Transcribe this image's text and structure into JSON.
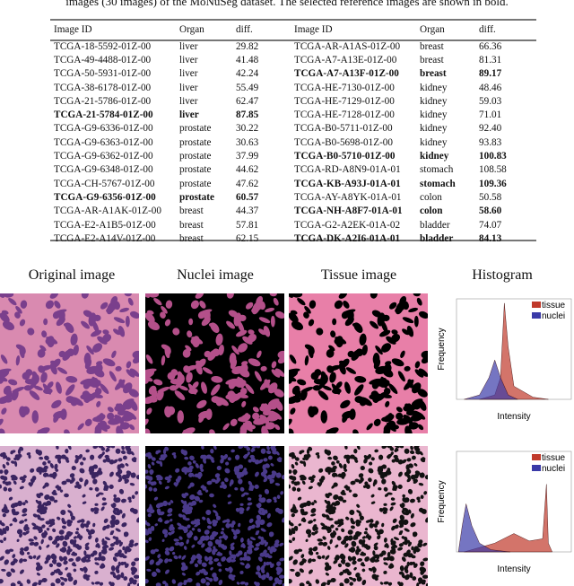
{
  "caption": "images (30 images) of the MoNuSeg dataset. The selected reference images are shown in bold.",
  "table": {
    "headers": [
      "Image ID",
      "Organ",
      "diff.",
      "Image ID",
      "Organ",
      "diff."
    ],
    "rows": [
      [
        {
          "id": "TCGA-18-5592-01Z-00",
          "organ": "liver",
          "diff": "29.82",
          "bold": false
        },
        {
          "id": "TCGA-AR-A1AS-01Z-00",
          "organ": "breast",
          "diff": "66.36",
          "bold": false
        }
      ],
      [
        {
          "id": "TCGA-49-4488-01Z-00",
          "organ": "liver",
          "diff": "41.48",
          "bold": false
        },
        {
          "id": "TCGA-A7-A13E-01Z-00",
          "organ": "breast",
          "diff": "81.31",
          "bold": false
        }
      ],
      [
        {
          "id": "TCGA-50-5931-01Z-00",
          "organ": "liver",
          "diff": "42.24",
          "bold": false
        },
        {
          "id": "TCGA-A7-A13F-01Z-00",
          "organ": "breast",
          "diff": "89.17",
          "bold": true
        }
      ],
      [
        {
          "id": "TCGA-38-6178-01Z-00",
          "organ": "liver",
          "diff": "55.49",
          "bold": false
        },
        {
          "id": "TCGA-HE-7130-01Z-00",
          "organ": "kidney",
          "diff": "48.46",
          "bold": false
        }
      ],
      [
        {
          "id": "TCGA-21-5786-01Z-00",
          "organ": "liver",
          "diff": "62.47",
          "bold": false
        },
        {
          "id": "TCGA-HE-7129-01Z-00",
          "organ": "kidney",
          "diff": "59.03",
          "bold": false
        }
      ],
      [
        {
          "id": "TCGA-21-5784-01Z-00",
          "organ": "liver",
          "diff": "87.85",
          "bold": true
        },
        {
          "id": "TCGA-HE-7128-01Z-00",
          "organ": "kidney",
          "diff": "71.01",
          "bold": false
        }
      ],
      [
        {
          "id": "TCGA-G9-6336-01Z-00",
          "organ": "prostate",
          "diff": "30.22",
          "bold": false
        },
        {
          "id": "TCGA-B0-5711-01Z-00",
          "organ": "kidney",
          "diff": "92.40",
          "bold": false
        }
      ],
      [
        {
          "id": "TCGA-G9-6363-01Z-00",
          "organ": "prostate",
          "diff": "30.63",
          "bold": false
        },
        {
          "id": "TCGA-B0-5698-01Z-00",
          "organ": "kidney",
          "diff": "93.83",
          "bold": false
        }
      ],
      [
        {
          "id": "TCGA-G9-6362-01Z-00",
          "organ": "prostate",
          "diff": "37.99",
          "bold": false
        },
        {
          "id": "TCGA-B0-5710-01Z-00",
          "organ": "kidney",
          "diff": "100.83",
          "bold": true
        }
      ],
      [
        {
          "id": "TCGA-G9-6348-01Z-00",
          "organ": "prostate",
          "diff": "44.62",
          "bold": false
        },
        {
          "id": "TCGA-RD-A8N9-01A-01",
          "organ": "stomach",
          "diff": "108.58",
          "bold": false
        }
      ],
      [
        {
          "id": "TCGA-CH-5767-01Z-00",
          "organ": "prostate",
          "diff": "47.62",
          "bold": false
        },
        {
          "id": "TCGA-KB-A93J-01A-01",
          "organ": "stomach",
          "diff": "109.36",
          "bold": true
        }
      ],
      [
        {
          "id": "TCGA-G9-6356-01Z-00",
          "organ": "prostate",
          "diff": "60.57",
          "bold": true
        },
        {
          "id": "TCGA-AY-A8YK-01A-01",
          "organ": "colon",
          "diff": "50.58",
          "bold": false
        }
      ],
      [
        {
          "id": "TCGA-AR-A1AK-01Z-00",
          "organ": "breast",
          "diff": "44.37",
          "bold": false
        },
        {
          "id": "TCGA-NH-A8F7-01A-01",
          "organ": "colon",
          "diff": "58.60",
          "bold": true
        }
      ],
      [
        {
          "id": "TCGA-E2-A1B5-01Z-00",
          "organ": "breast",
          "diff": "57.81",
          "bold": false
        },
        {
          "id": "TCGA-G2-A2EK-01A-02",
          "organ": "bladder",
          "diff": "74.07",
          "bold": false
        }
      ],
      [
        {
          "id": "TCGA-E2-A14V-01Z-00",
          "organ": "breast",
          "diff": "62.15",
          "bold": false
        },
        {
          "id": "TCGA-DK-A2I6-01A-01",
          "organ": "bladder",
          "diff": "84.13",
          "bold": true
        }
      ]
    ]
  },
  "panels": {
    "original": "Original image",
    "nuclei": "Nuclei image",
    "tissue": "Tissue image",
    "histogram": "Histogram"
  },
  "chart_data": [
    {
      "type": "area",
      "xlabel": "Intensity",
      "ylabel": "Frequency",
      "legend": "top-right",
      "series": [
        {
          "name": "tissue",
          "color": "#c0392b",
          "x": [
            60,
            100,
            115,
            125,
            135,
            150,
            200,
            240
          ],
          "y": [
            0,
            0.1,
            0.5,
            2.2,
            1.2,
            0.3,
            0.05,
            0
          ]
        },
        {
          "name": "nuclei",
          "color": "#3a3aa8",
          "x": [
            20,
            60,
            85,
            100,
            115,
            135,
            160
          ],
          "y": [
            0,
            0.1,
            0.5,
            0.9,
            0.5,
            0.1,
            0
          ]
        }
      ]
    },
    {
      "type": "area",
      "xlabel": "Intensity",
      "ylabel": "Frequency",
      "legend": "top-right",
      "series": [
        {
          "name": "tissue",
          "color": "#c0392b",
          "x": [
            20,
            60,
            100,
            150,
            190,
            225,
            235,
            240,
            250
          ],
          "y": [
            0,
            0.1,
            0.2,
            0.42,
            0.25,
            0.3,
            1.55,
            0.2,
            0
          ]
        },
        {
          "name": "nuclei",
          "color": "#3a3aa8",
          "x": [
            5,
            15,
            25,
            40,
            60,
            90,
            140
          ],
          "y": [
            0,
            0.6,
            1.1,
            0.6,
            0.2,
            0.05,
            0
          ]
        }
      ]
    }
  ]
}
